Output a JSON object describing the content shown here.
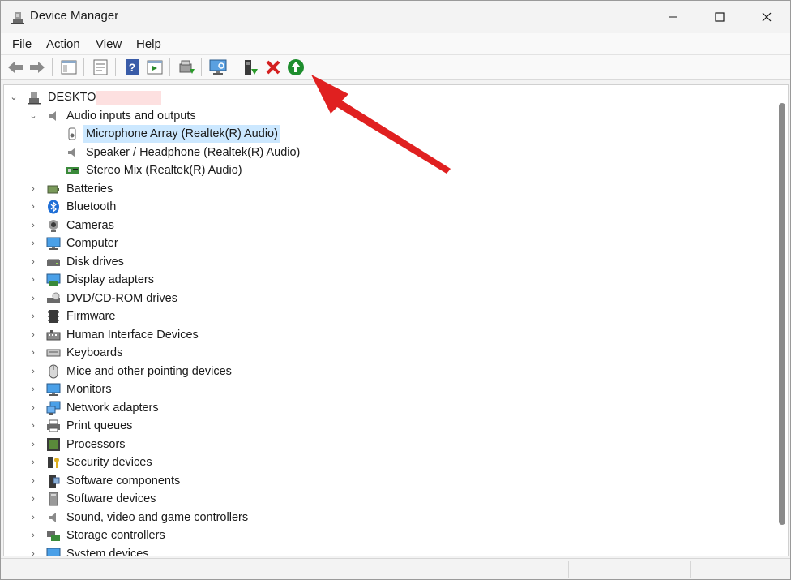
{
  "window": {
    "title": "Device Manager"
  },
  "menu": [
    {
      "label": "File"
    },
    {
      "label": "Action"
    },
    {
      "label": "View"
    },
    {
      "label": "Help"
    }
  ],
  "toolbar": {
    "buttons": [
      {
        "icon": "back-arrow-icon"
      },
      {
        "icon": "forward-arrow-icon"
      },
      {
        "icon": "show-hide-console-tree-icon"
      },
      {
        "icon": "properties-icon"
      },
      {
        "icon": "help-icon"
      },
      {
        "icon": "action-pane-icon"
      },
      {
        "icon": "update-driver-icon"
      },
      {
        "icon": "scan-hardware-changes-icon"
      },
      {
        "icon": "enable-device-icon"
      },
      {
        "icon": "uninstall-device-icon"
      },
      {
        "icon": "update-driver-software-icon"
      }
    ]
  },
  "tree": {
    "root": {
      "label": "DESKTOP"
    },
    "expanded_category": {
      "label": "Audio inputs and outputs",
      "children": [
        {
          "label": "Microphone Array (Realtek(R) Audio)",
          "selected": true
        },
        {
          "label": "Speaker / Headphone (Realtek(R) Audio)",
          "selected": false
        },
        {
          "label": "Stereo Mix (Realtek(R) Audio)",
          "selected": false
        }
      ]
    },
    "categories": [
      {
        "label": "Batteries",
        "icon": "battery-icon"
      },
      {
        "label": "Bluetooth",
        "icon": "bluetooth-icon"
      },
      {
        "label": "Cameras",
        "icon": "camera-icon"
      },
      {
        "label": "Computer",
        "icon": "computer-icon"
      },
      {
        "label": "Disk drives",
        "icon": "disk-drive-icon"
      },
      {
        "label": "Display adapters",
        "icon": "display-adapter-icon"
      },
      {
        "label": "DVD/CD-ROM drives",
        "icon": "dvd-drive-icon"
      },
      {
        "label": "Firmware",
        "icon": "firmware-icon"
      },
      {
        "label": "Human Interface Devices",
        "icon": "hid-icon"
      },
      {
        "label": "Keyboards",
        "icon": "keyboard-icon"
      },
      {
        "label": "Mice and other pointing devices",
        "icon": "mouse-icon"
      },
      {
        "label": "Monitors",
        "icon": "monitor-icon"
      },
      {
        "label": "Network adapters",
        "icon": "network-adapter-icon"
      },
      {
        "label": "Print queues",
        "icon": "printer-icon"
      },
      {
        "label": "Processors",
        "icon": "processor-icon"
      },
      {
        "label": "Security devices",
        "icon": "security-device-icon"
      },
      {
        "label": "Software components",
        "icon": "software-component-icon"
      },
      {
        "label": "Software devices",
        "icon": "software-device-icon"
      },
      {
        "label": "Sound, video and game controllers",
        "icon": "speaker-icon"
      },
      {
        "label": "Storage controllers",
        "icon": "storage-controller-icon"
      },
      {
        "label": "System devices",
        "icon": "system-device-icon"
      }
    ]
  },
  "colors": {
    "selection": "#cce8ff",
    "annotation_arrow": "#e02020",
    "redaction": "#fde0e0"
  }
}
